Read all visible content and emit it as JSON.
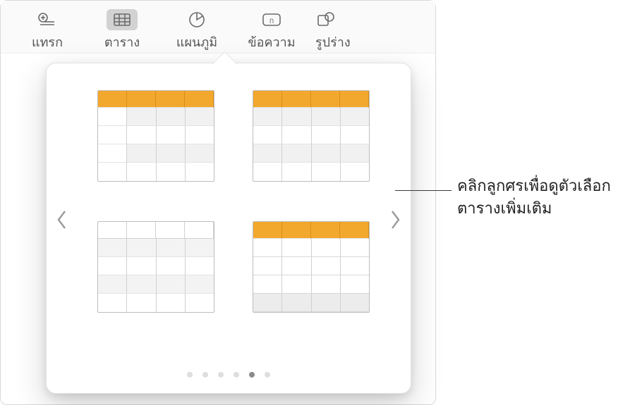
{
  "toolbar": {
    "items": [
      {
        "label": "แทรก",
        "icon": "insert-icon"
      },
      {
        "label": "ตาราง",
        "icon": "table-icon"
      },
      {
        "label": "แผนภูมิ",
        "icon": "chart-icon"
      },
      {
        "label": "ข้อความ",
        "icon": "text-icon"
      },
      {
        "label": "รูปร่าง",
        "icon": "shape-icon"
      }
    ],
    "active_index": 1
  },
  "popover": {
    "thumbs": [
      {
        "name": "table-style-header-leftcol-striped",
        "header": "orange",
        "leftcol": true
      },
      {
        "name": "table-style-header-striped",
        "header": "orange",
        "leftcol": false
      },
      {
        "name": "table-style-plain-striped",
        "header": "plain",
        "leftcol": false
      },
      {
        "name": "table-style-header-leftcol-footer",
        "header": "orange",
        "leftcol": true,
        "footer": true
      }
    ],
    "page_count": 6,
    "active_page": 5
  },
  "callout": {
    "line1": "คลิกลูกศรเพื่อดูตัวเลือก",
    "line2": "ตารางเพิ่มเติม"
  },
  "colors": {
    "accent": "#f2a82d"
  }
}
